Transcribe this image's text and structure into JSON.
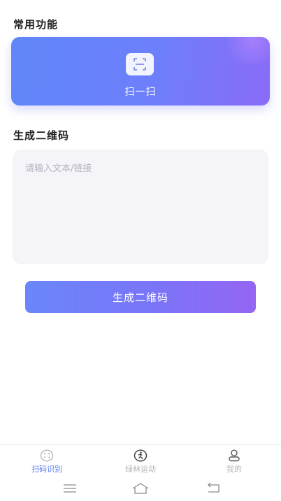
{
  "sections": {
    "common_title": "常用功能",
    "generate_title": "生成二维码"
  },
  "scan_card": {
    "label": "扫一扫",
    "icon": "scan-icon"
  },
  "qr_input": {
    "placeholder": "请输入文本/链接",
    "value": ""
  },
  "generate_button": {
    "label": "生成二维码"
  },
  "tab_bar": {
    "items": [
      {
        "label": "扫码识别",
        "icon": "scan-circle-icon",
        "active": true
      },
      {
        "label": "绿林运动",
        "icon": "runner-icon",
        "active": false
      },
      {
        "label": "我的",
        "icon": "person-icon",
        "active": false
      }
    ]
  },
  "system_nav": {
    "buttons": [
      "menu-icon",
      "home-icon",
      "back-icon"
    ]
  },
  "colors": {
    "accent": "#5b7ff2",
    "card_gradient_start": "#5f86f8",
    "card_gradient_end": "#8a6bf7",
    "input_background": "#f4f4f9",
    "inactive_tab": "#b5b5b5"
  }
}
